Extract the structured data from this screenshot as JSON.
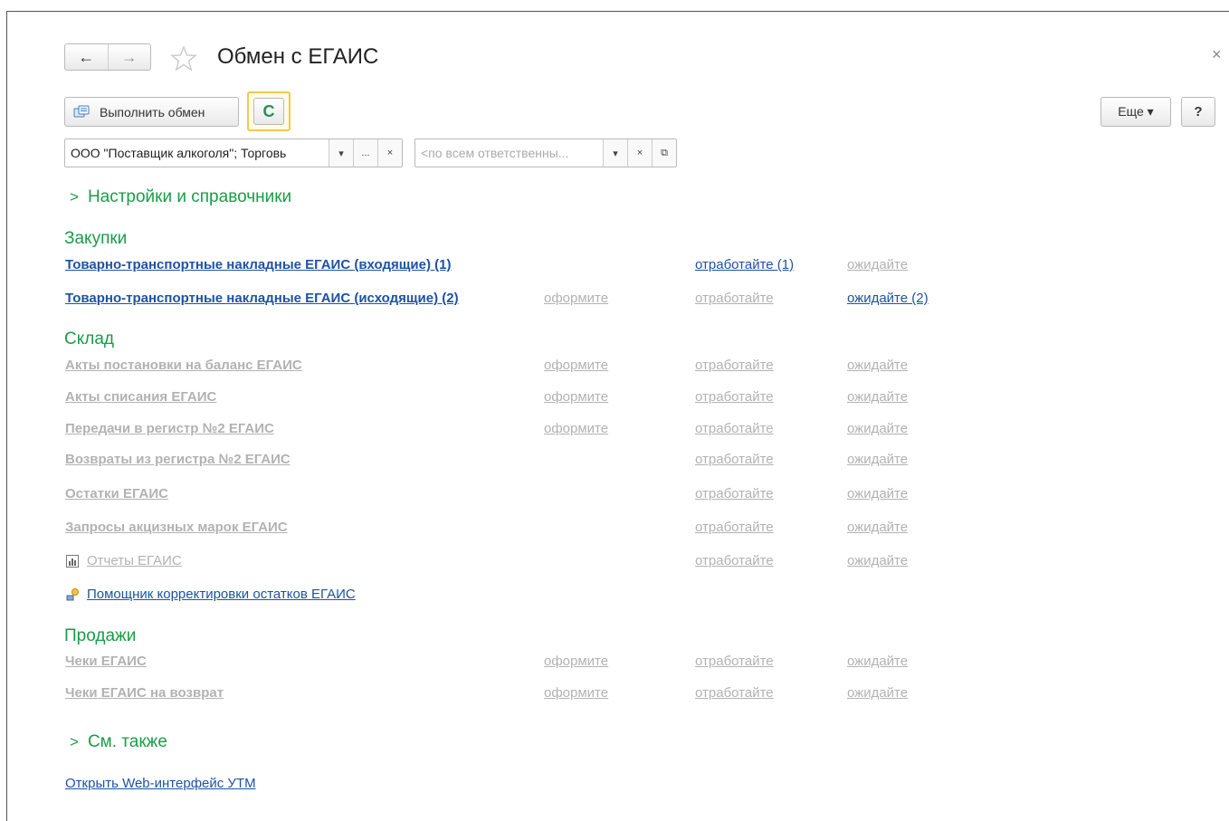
{
  "window": {
    "title": "Обмен с ЕГАИС",
    "close": "×"
  },
  "nav": {
    "back": "←",
    "forward": "→"
  },
  "toolbar": {
    "exchange_label": "Выполнить обмен",
    "refresh": "C",
    "more_label": "Еще ▾",
    "help_label": "?"
  },
  "filters": {
    "org_value": "ООО \"Поставщик алкоголя\"; Торговь",
    "responsible_placeholder": "<по всем ответственны...",
    "dropdown": "▾",
    "ellipsis": "...",
    "clear": "×",
    "open": "⧉"
  },
  "settings_group": {
    "label": "Настройки и справочники"
  },
  "sections": {
    "purchases": {
      "title": "Закупки",
      "rows": [
        {
          "label": "Товарно-транспортные накладные ЕГАИС (входящие) (1)",
          "issue": "",
          "process": "отработайте (1)",
          "wait": "ожидайте"
        },
        {
          "label": "Товарно-транспортные накладные ЕГАИС (исходящие) (2)",
          "issue": "оформите",
          "process": "отработайте",
          "wait": "ожидайте (2)"
        }
      ]
    },
    "warehouse": {
      "title": "Склад",
      "rows": [
        {
          "label": "Акты постановки на баланс ЕГАИС",
          "issue": "оформите",
          "process": "отработайте",
          "wait": "ожидайте"
        },
        {
          "label": "Акты списания ЕГАИС",
          "issue": "оформите",
          "process": "отработайте",
          "wait": "ожидайте"
        },
        {
          "label": "Передачи в регистр №2 ЕГАИС",
          "issue": "оформите",
          "process": "отработайте",
          "wait": "ожидайте"
        },
        {
          "label": "Возвраты из регистра №2 ЕГАИС",
          "issue": "",
          "process": "отработайте",
          "wait": "ожидайте"
        },
        {
          "label": "Остатки ЕГАИС",
          "issue": "",
          "process": "отработайте",
          "wait": "ожидайте"
        },
        {
          "label": "Запросы акцизных марок ЕГАИС",
          "issue": "",
          "process": "отработайте",
          "wait": "ожидайте"
        },
        {
          "label": "Отчеты ЕГАИС",
          "issue": "",
          "process": "отработайте",
          "wait": "ожидайте"
        }
      ],
      "assistant": "Помощник корректировки остатков ЕГАИС"
    },
    "sales": {
      "title": "Продажи",
      "rows": [
        {
          "label": "Чеки ЕГАИС",
          "issue": "оформите",
          "process": "отработайте",
          "wait": "ожидайте"
        },
        {
          "label": "Чеки ЕГАИС на возврат",
          "issue": "оформите",
          "process": "отработайте",
          "wait": "ожидайте"
        }
      ]
    }
  },
  "see_also": {
    "label": "См. также",
    "utm_link": "Открыть Web-интерфейс УТМ"
  },
  "colors": {
    "section_green": "#1a9c47",
    "link_blue": "#1e52a4",
    "disabled_gray": "#b2b2b2",
    "focus_yellow": "#f2c94c"
  }
}
